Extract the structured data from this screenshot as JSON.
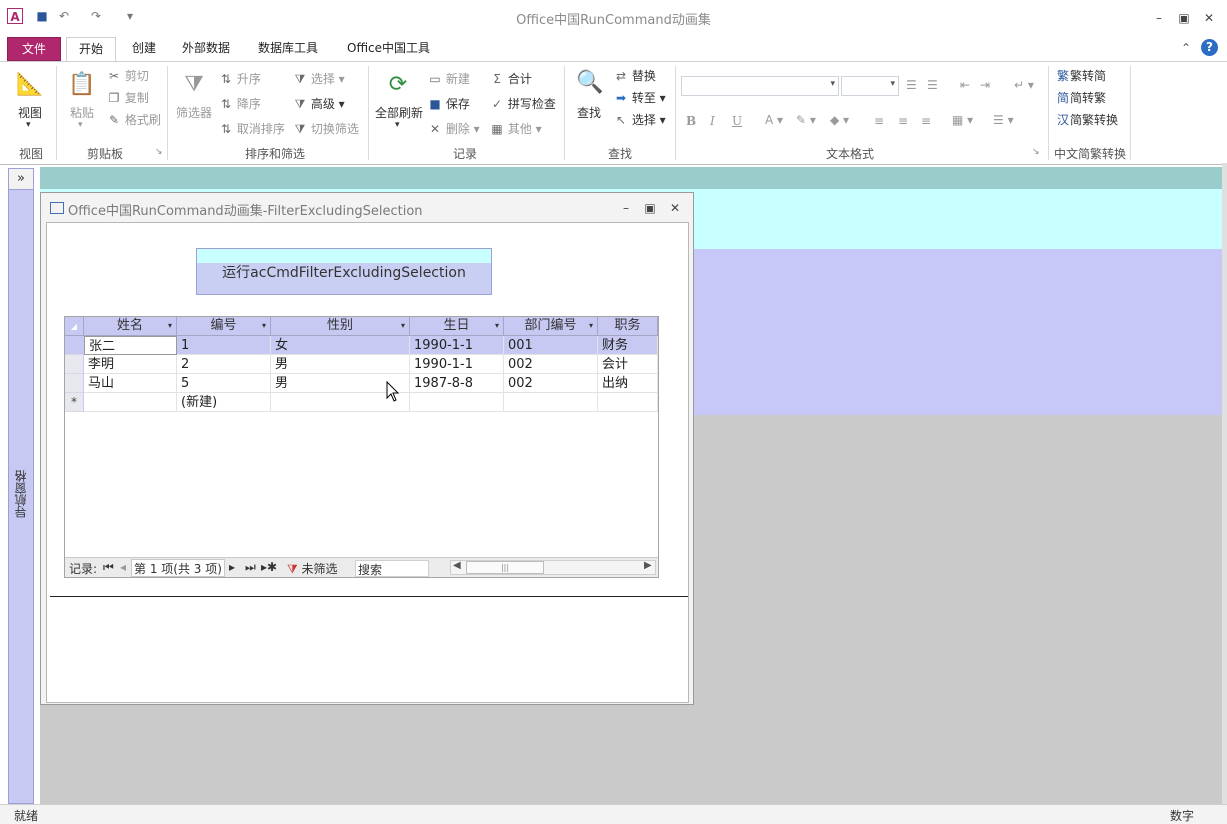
{
  "app": {
    "title": "Office中国RunCommand动画集",
    "icon_letter": "A",
    "accent_file_tab": "#b0276d"
  },
  "quick_access": {
    "save_icon": "save-icon",
    "undo_icon": "undo-icon",
    "redo_icon": "redo-icon",
    "customize_icon": "dropdown-arrow-icon"
  },
  "window_controls": {
    "minimize": "▭",
    "restore": "⧉",
    "close": "✕"
  },
  "tabs": [
    {
      "label": "文件"
    },
    {
      "label": "开始"
    },
    {
      "label": "创建"
    },
    {
      "label": "外部数据"
    },
    {
      "label": "数据库工具"
    },
    {
      "label": "Office中国工具"
    }
  ],
  "ribbon": {
    "view": {
      "label": "视图",
      "group": "视图"
    },
    "clipboard": {
      "paste": "粘贴",
      "cut": "剪切",
      "copy": "复制",
      "format_painter": "格式刷",
      "group": "剪贴板"
    },
    "sort_filter": {
      "filter": "筛选器",
      "ascending": "升序",
      "descending": "降序",
      "remove_sort": "取消排序",
      "selection": "选择",
      "advanced": "高级",
      "toggle_filter": "切换筛选",
      "group": "排序和筛选"
    },
    "records": {
      "refresh_all": "全部刷新",
      "new": "新建",
      "save": "保存",
      "delete": "删除",
      "totals": "合计",
      "spelling": "拼写检查",
      "more": "其他",
      "group": "记录"
    },
    "find": {
      "find": "查找",
      "replace": "替换",
      "goto": "转至",
      "select": "选择",
      "group": "查找"
    },
    "text_format": {
      "bold": "B",
      "italic": "I",
      "underline": "U",
      "font_color": "A",
      "group": "文本格式"
    },
    "chinese_conv": {
      "to_simplified": "繁转简",
      "to_traditional": "简转繁",
      "conversion": "简繁转换",
      "group": "中文简繁转换"
    }
  },
  "nav_pane": {
    "label": "导航窗格",
    "toggle": "»"
  },
  "form": {
    "title": "Office中国RunCommand动画集-FilterExcludingSelection",
    "run_button": "运行acCmdFilterExcludingSelection",
    "datasheet": {
      "columns": [
        "姓名",
        "编号",
        "性别",
        "生日",
        "部门编号",
        "职务"
      ],
      "rows": [
        [
          "张二",
          "1",
          "女",
          "1990-1-1",
          "001",
          "财务"
        ],
        [
          "李明",
          "2",
          "男",
          "1990-1-1",
          "002",
          "会计"
        ],
        [
          "马山",
          "5",
          "男",
          "1987-8-8",
          "002",
          "出纳"
        ]
      ],
      "new_row_marker": "*",
      "new_row_label": "(新建)",
      "navigator": {
        "records_label": "记录:",
        "position": "第 1 项(共 3 项)",
        "filter_status": "未筛选",
        "search_placeholder": "搜索"
      }
    }
  },
  "status": {
    "left": "就绪",
    "right": "数字"
  }
}
